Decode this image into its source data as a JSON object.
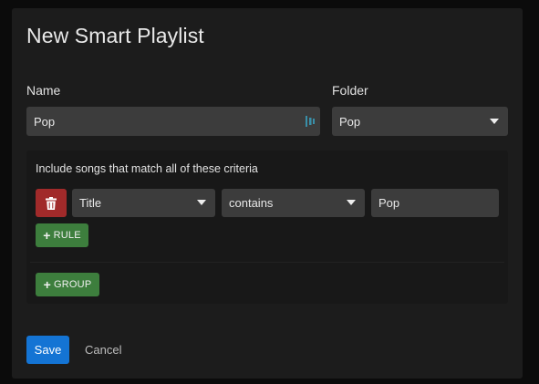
{
  "dialog": {
    "title": "New Smart Playlist"
  },
  "name_field": {
    "label": "Name",
    "value": "Pop",
    "icon": "lastpass-icon"
  },
  "folder_field": {
    "label": "Folder",
    "selected": "Pop"
  },
  "criteria": {
    "heading": "Include songs that match all of these criteria",
    "rules": [
      {
        "field": "Title",
        "operator": "contains",
        "value": "Pop"
      }
    ],
    "add_rule_label": "RULE",
    "add_group_label": "GROUP"
  },
  "actions": {
    "save_label": "Save",
    "cancel_label": "Cancel"
  },
  "colors": {
    "dialog_bg": "#1c1c1c",
    "field_bg": "#3c3c3c",
    "danger": "#a12a2a",
    "success": "#3d7e3d",
    "primary": "#1474d4"
  }
}
